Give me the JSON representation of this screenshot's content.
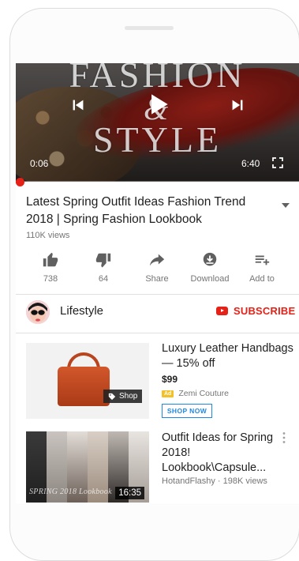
{
  "player": {
    "overlay_line1": "FASHION",
    "overlay_line2": "&",
    "overlay_line3": "STYLE",
    "current_time": "0:06",
    "duration": "6:40",
    "progress_fraction": 0.015
  },
  "video": {
    "title": "Latest Spring Outfit Ideas Fashion Trend 2018 | Spring Fashion Lookbook",
    "views": "110K views"
  },
  "actions": {
    "like_count": "738",
    "dislike_count": "64",
    "share_label": "Share",
    "download_label": "Download",
    "add_to_label": "Add to"
  },
  "channel": {
    "name": "Lifestyle",
    "subscribe_label": "SUBSCRIBE"
  },
  "ad": {
    "shop_tag": "Shop",
    "title": "Luxury Leather Handbags — 15% off",
    "price": "$99",
    "badge": "Ad",
    "advertiser": "Zemi Couture",
    "cta": "SHOP NOW"
  },
  "next_video": {
    "thumb_caption": "SPRING 2018 Lookbook",
    "duration": "16:35",
    "title": "Outfit Ideas for Spring 2018! Lookbook\\Capsule...",
    "meta": "HotandFlashy · 198K views"
  },
  "colors": {
    "accent_red": "#e62117",
    "link_blue": "#1e88e5",
    "ad_badge": "#f3c026"
  }
}
